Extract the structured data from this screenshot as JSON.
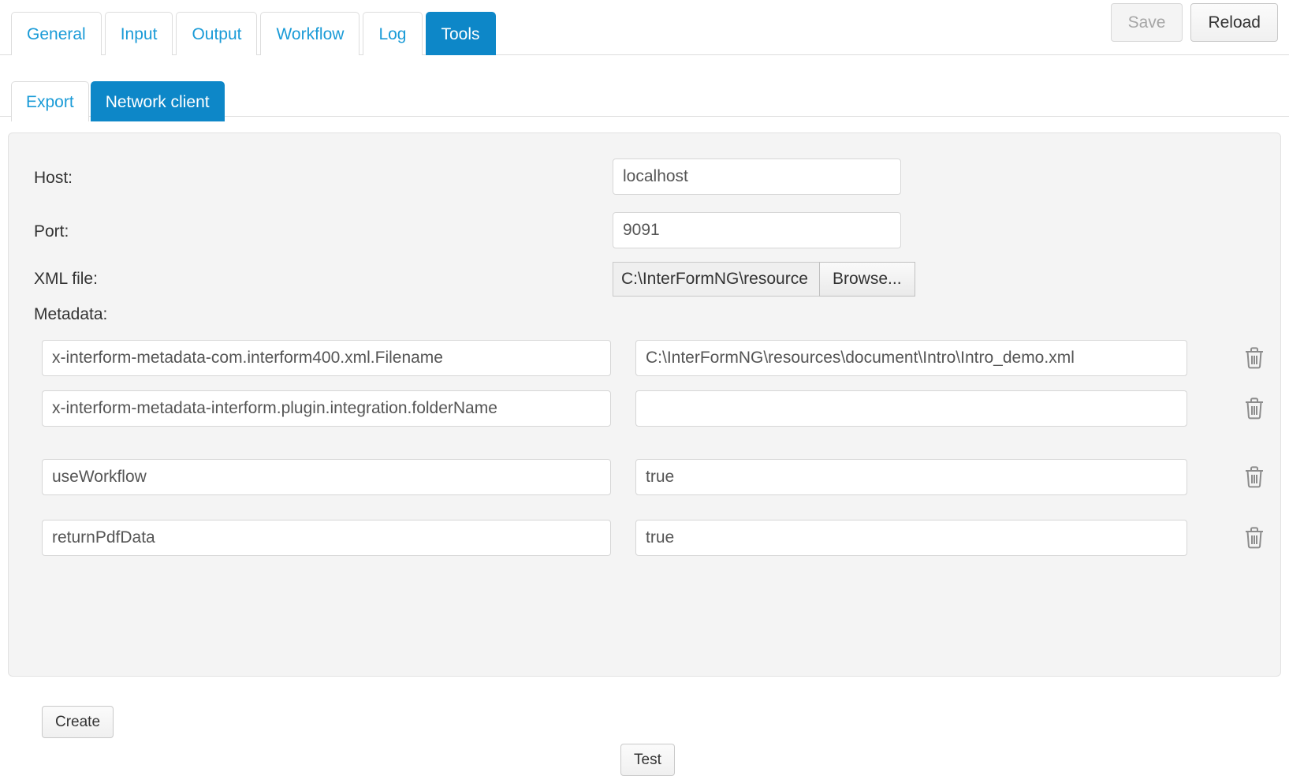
{
  "top_tabs": [
    {
      "label": "General",
      "active": false
    },
    {
      "label": "Input",
      "active": false
    },
    {
      "label": "Output",
      "active": false
    },
    {
      "label": "Workflow",
      "active": false
    },
    {
      "label": "Log",
      "active": false
    },
    {
      "label": "Tools",
      "active": true
    }
  ],
  "sub_tabs": [
    {
      "label": "Export",
      "active": false
    },
    {
      "label": "Network client",
      "active": true
    }
  ],
  "top_buttons": {
    "save_label": "Save",
    "reload_label": "Reload"
  },
  "form": {
    "host_label": "Host:",
    "host_value": "localhost",
    "port_label": "Port:",
    "port_value": "9091",
    "xml_file_label": "XML file:",
    "xml_file_path": "C:\\InterFormNG\\resource",
    "browse_label": "Browse...",
    "metadata_label": "Metadata:"
  },
  "metadata_rows": [
    {
      "key": "x-interform-metadata-com.interform400.xml.Filename",
      "value": "C:\\InterFormNG\\resources\\document\\Intro\\Intro_demo.xml"
    },
    {
      "key": "x-interform-metadata-interform.plugin.integration.folderName",
      "value": ""
    },
    {
      "key": "useWorkflow",
      "value": "true"
    },
    {
      "key": "returnPdfData",
      "value": "true"
    }
  ],
  "actions": {
    "create_label": "Create",
    "test_label": "Test"
  },
  "icons": {
    "delete": "trash-icon"
  },
  "colors": {
    "accent": "#0d87c8",
    "link": "#1a9bd7",
    "panel_bg": "#f4f4f4",
    "border": "#dddddd"
  }
}
